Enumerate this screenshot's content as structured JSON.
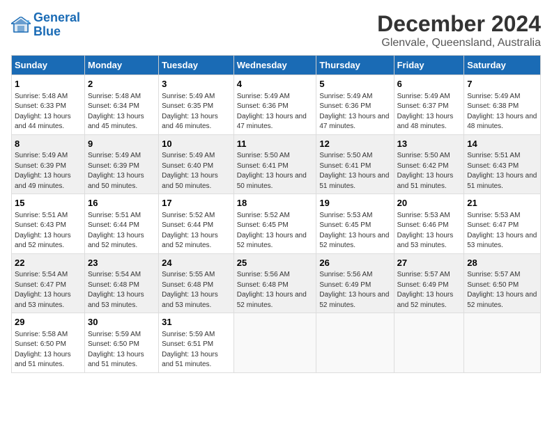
{
  "logo": {
    "line1": "General",
    "line2": "Blue"
  },
  "title": "December 2024",
  "subtitle": "Glenvale, Queensland, Australia",
  "days_of_week": [
    "Sunday",
    "Monday",
    "Tuesday",
    "Wednesday",
    "Thursday",
    "Friday",
    "Saturday"
  ],
  "weeks": [
    [
      {
        "day": "1",
        "sunrise": "5:48 AM",
        "sunset": "6:33 PM",
        "daylight": "13 hours and 44 minutes."
      },
      {
        "day": "2",
        "sunrise": "5:48 AM",
        "sunset": "6:34 PM",
        "daylight": "13 hours and 45 minutes."
      },
      {
        "day": "3",
        "sunrise": "5:49 AM",
        "sunset": "6:35 PM",
        "daylight": "13 hours and 46 minutes."
      },
      {
        "day": "4",
        "sunrise": "5:49 AM",
        "sunset": "6:36 PM",
        "daylight": "13 hours and 47 minutes."
      },
      {
        "day": "5",
        "sunrise": "5:49 AM",
        "sunset": "6:36 PM",
        "daylight": "13 hours and 47 minutes."
      },
      {
        "day": "6",
        "sunrise": "5:49 AM",
        "sunset": "6:37 PM",
        "daylight": "13 hours and 48 minutes."
      },
      {
        "day": "7",
        "sunrise": "5:49 AM",
        "sunset": "6:38 PM",
        "daylight": "13 hours and 48 minutes."
      }
    ],
    [
      {
        "day": "8",
        "sunrise": "5:49 AM",
        "sunset": "6:39 PM",
        "daylight": "13 hours and 49 minutes."
      },
      {
        "day": "9",
        "sunrise": "5:49 AM",
        "sunset": "6:39 PM",
        "daylight": "13 hours and 50 minutes."
      },
      {
        "day": "10",
        "sunrise": "5:49 AM",
        "sunset": "6:40 PM",
        "daylight": "13 hours and 50 minutes."
      },
      {
        "day": "11",
        "sunrise": "5:50 AM",
        "sunset": "6:41 PM",
        "daylight": "13 hours and 50 minutes."
      },
      {
        "day": "12",
        "sunrise": "5:50 AM",
        "sunset": "6:41 PM",
        "daylight": "13 hours and 51 minutes."
      },
      {
        "day": "13",
        "sunrise": "5:50 AM",
        "sunset": "6:42 PM",
        "daylight": "13 hours and 51 minutes."
      },
      {
        "day": "14",
        "sunrise": "5:51 AM",
        "sunset": "6:43 PM",
        "daylight": "13 hours and 51 minutes."
      }
    ],
    [
      {
        "day": "15",
        "sunrise": "5:51 AM",
        "sunset": "6:43 PM",
        "daylight": "13 hours and 52 minutes."
      },
      {
        "day": "16",
        "sunrise": "5:51 AM",
        "sunset": "6:44 PM",
        "daylight": "13 hours and 52 minutes."
      },
      {
        "day": "17",
        "sunrise": "5:52 AM",
        "sunset": "6:44 PM",
        "daylight": "13 hours and 52 minutes."
      },
      {
        "day": "18",
        "sunrise": "5:52 AM",
        "sunset": "6:45 PM",
        "daylight": "13 hours and 52 minutes."
      },
      {
        "day": "19",
        "sunrise": "5:53 AM",
        "sunset": "6:45 PM",
        "daylight": "13 hours and 52 minutes."
      },
      {
        "day": "20",
        "sunrise": "5:53 AM",
        "sunset": "6:46 PM",
        "daylight": "13 hours and 53 minutes."
      },
      {
        "day": "21",
        "sunrise": "5:53 AM",
        "sunset": "6:47 PM",
        "daylight": "13 hours and 53 minutes."
      }
    ],
    [
      {
        "day": "22",
        "sunrise": "5:54 AM",
        "sunset": "6:47 PM",
        "daylight": "13 hours and 53 minutes."
      },
      {
        "day": "23",
        "sunrise": "5:54 AM",
        "sunset": "6:48 PM",
        "daylight": "13 hours and 53 minutes."
      },
      {
        "day": "24",
        "sunrise": "5:55 AM",
        "sunset": "6:48 PM",
        "daylight": "13 hours and 53 minutes."
      },
      {
        "day": "25",
        "sunrise": "5:56 AM",
        "sunset": "6:48 PM",
        "daylight": "13 hours and 52 minutes."
      },
      {
        "day": "26",
        "sunrise": "5:56 AM",
        "sunset": "6:49 PM",
        "daylight": "13 hours and 52 minutes."
      },
      {
        "day": "27",
        "sunrise": "5:57 AM",
        "sunset": "6:49 PM",
        "daylight": "13 hours and 52 minutes."
      },
      {
        "day": "28",
        "sunrise": "5:57 AM",
        "sunset": "6:50 PM",
        "daylight": "13 hours and 52 minutes."
      }
    ],
    [
      {
        "day": "29",
        "sunrise": "5:58 AM",
        "sunset": "6:50 PM",
        "daylight": "13 hours and 51 minutes."
      },
      {
        "day": "30",
        "sunrise": "5:59 AM",
        "sunset": "6:50 PM",
        "daylight": "13 hours and 51 minutes."
      },
      {
        "day": "31",
        "sunrise": "5:59 AM",
        "sunset": "6:51 PM",
        "daylight": "13 hours and 51 minutes."
      },
      null,
      null,
      null,
      null
    ]
  ]
}
